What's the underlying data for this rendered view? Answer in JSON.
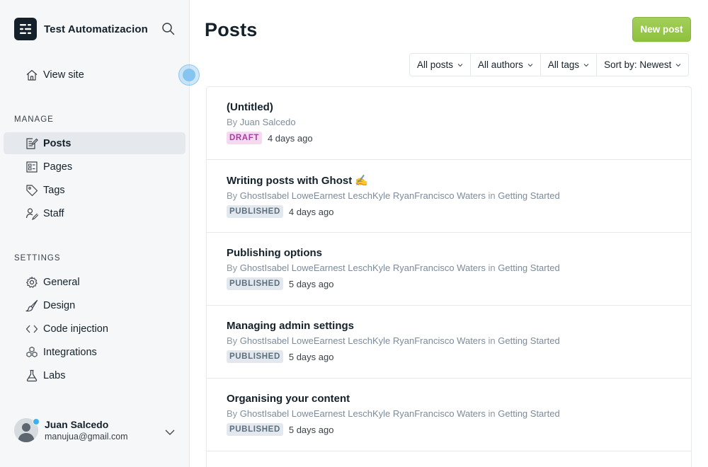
{
  "app": {
    "site_name": "Test Automatizacion"
  },
  "sidebar": {
    "view_site": "View site",
    "manage_heading": "MANAGE",
    "manage_items": [
      {
        "label": "Posts",
        "icon": "posts-icon"
      },
      {
        "label": "Pages",
        "icon": "pages-icon"
      },
      {
        "label": "Tags",
        "icon": "tag-icon"
      },
      {
        "label": "Staff",
        "icon": "staff-icon"
      }
    ],
    "settings_heading": "SETTINGS",
    "settings_items": [
      {
        "label": "General",
        "icon": "gear-icon"
      },
      {
        "label": "Design",
        "icon": "brush-icon"
      },
      {
        "label": "Code injection",
        "icon": "code-icon"
      },
      {
        "label": "Integrations",
        "icon": "integrations-icon"
      },
      {
        "label": "Labs",
        "icon": "flask-icon"
      }
    ],
    "user": {
      "name": "Juan Salcedo",
      "email": "manujua@gmail.com"
    }
  },
  "main": {
    "title": "Posts",
    "new_post_label": "New post",
    "filters": [
      "All posts",
      "All authors",
      "All tags",
      "Sort by: Newest"
    ],
    "posts": [
      {
        "title": "(Untitled)",
        "by": "By",
        "authors": "Juan Salcedo",
        "in": "",
        "tag": "",
        "status": "DRAFT",
        "time": "4 days ago"
      },
      {
        "title": "Writing posts with Ghost ✍️",
        "by": "By",
        "authors": "GhostIsabel LoweEarnest LeschKyle RyanFrancisco Waters",
        "in": "in",
        "tag": "Getting Started",
        "status": "PUBLISHED",
        "time": "4 days ago"
      },
      {
        "title": "Publishing options",
        "by": "By",
        "authors": "GhostIsabel LoweEarnest LeschKyle RyanFrancisco Waters",
        "in": "in",
        "tag": "Getting Started",
        "status": "PUBLISHED",
        "time": "5 days ago"
      },
      {
        "title": "Managing admin settings",
        "by": "By",
        "authors": "GhostIsabel LoweEarnest LeschKyle RyanFrancisco Waters",
        "in": "in",
        "tag": "Getting Started",
        "status": "PUBLISHED",
        "time": "5 days ago"
      },
      {
        "title": "Organising your content",
        "by": "By",
        "authors": "GhostIsabel LoweEarnest LeschKyle RyanFrancisco Waters",
        "in": "in",
        "tag": "Getting Started",
        "status": "PUBLISHED",
        "time": "5 days ago"
      }
    ]
  },
  "colors": {
    "accent_green": "#9bca4f",
    "draft_badge": "#f4d9f1",
    "published_badge": "#e2e8ee",
    "sidebar_bg": "#f5f7f8"
  }
}
